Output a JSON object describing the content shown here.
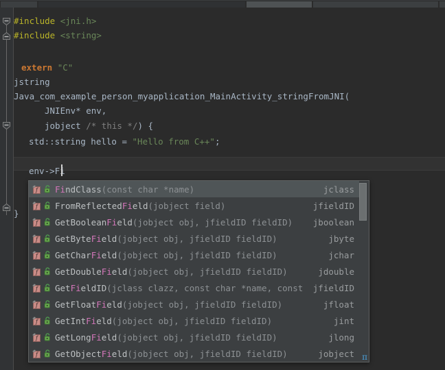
{
  "window": {
    "app": "Android Studio C++ Editor",
    "theme_background": "#2b2b2b",
    "editor_background": "#2b2b2b",
    "gutter_background": "#313335"
  },
  "tabs": [
    {
      "label": "",
      "state": "inactive"
    },
    {
      "label": "",
      "state": "inactive"
    },
    {
      "label": "",
      "state": "active"
    },
    {
      "label": "",
      "state": "inactive"
    },
    {
      "label": "",
      "state": "inactive"
    }
  ],
  "editor": {
    "language": "C++",
    "current_line_index": 8,
    "lines": [
      {
        "indent": 0,
        "fold": "collapsible-start",
        "tokens": [
          {
            "text": "#include ",
            "cls": "k-pre"
          },
          {
            "text": "<jni.h>",
            "cls": "k-hdr"
          }
        ]
      },
      {
        "indent": 0,
        "fold": "collapsible-end",
        "tokens": [
          {
            "text": "#include ",
            "cls": "k-pre"
          },
          {
            "text": "<string>",
            "cls": "k-hdr"
          }
        ]
      },
      {
        "indent": 0,
        "fold": "none",
        "tokens": []
      },
      {
        "indent": 1,
        "fold": "none",
        "tokens": [
          {
            "text": "extern ",
            "cls": "k-kw"
          },
          {
            "text": "\"C\"",
            "cls": "k-str"
          }
        ]
      },
      {
        "indent": 0,
        "fold": "none",
        "tokens": [
          {
            "text": "jstring",
            "cls": "k-plain"
          }
        ]
      },
      {
        "indent": 0,
        "fold": "none",
        "tokens": [
          {
            "text": "Java_com_example_person_myapplication_MainActivity_stringFromJNI(",
            "cls": "k-plain"
          }
        ]
      },
      {
        "indent": 4,
        "fold": "none",
        "tokens": [
          {
            "text": "JNIEnv* env,",
            "cls": "k-plain"
          }
        ]
      },
      {
        "indent": 4,
        "fold": "collapsible-start",
        "tokens": [
          {
            "text": "jobject ",
            "cls": "k-plain"
          },
          {
            "text": "/* this */",
            "cls": "k-cmt"
          },
          {
            "text": ") {",
            "cls": "k-plain"
          }
        ]
      },
      {
        "indent": 2,
        "fold": "none",
        "tokens": [
          {
            "text": "std::string hello = ",
            "cls": "k-plain"
          },
          {
            "text": "\"Hello from C++\"",
            "cls": "k-str"
          },
          {
            "text": ";",
            "cls": "k-plain"
          }
        ]
      },
      {
        "indent": 0,
        "fold": "none",
        "tokens": []
      },
      {
        "indent": 2,
        "fold": "none",
        "current": true,
        "tokens": [
          {
            "text": "env->Fi",
            "cls": "k-plain"
          }
        ]
      },
      {
        "indent": 0,
        "fold": "none",
        "tokens": []
      },
      {
        "indent": 0,
        "fold": "none",
        "tokens": []
      },
      {
        "indent": 0,
        "fold": "collapsible-end",
        "tokens": [
          {
            "text": "}",
            "cls": "k-plain"
          }
        ]
      }
    ],
    "caret_text": "env->Fi"
  },
  "autocomplete": {
    "visible": true,
    "match_prefix": "Fi",
    "selected_index": 0,
    "items": [
      {
        "name_pre": "",
        "name_match": "Fi",
        "name_post": "ndClass",
        "params": "(const char *name)",
        "ret": "jclass",
        "icon": "function-icon",
        "access": "public-lock-icon"
      },
      {
        "name_pre": "FromReflected",
        "name_match": "Fi",
        "name_post": "eld",
        "params": "(jobject field)",
        "ret": "jfieldID",
        "icon": "function-icon",
        "access": "public-lock-icon"
      },
      {
        "name_pre": "GetBoolean",
        "name_match": "Fi",
        "name_post": "eld",
        "params": "(jobject obj, jfieldID fieldID)",
        "ret": "jboolean",
        "icon": "function-icon",
        "access": "public-lock-icon"
      },
      {
        "name_pre": "GetByte",
        "name_match": "Fi",
        "name_post": "eld",
        "params": "(jobject obj, jfieldID fieldID)",
        "ret": "jbyte",
        "icon": "function-icon",
        "access": "public-lock-icon"
      },
      {
        "name_pre": "GetChar",
        "name_match": "Fi",
        "name_post": "eld",
        "params": "(jobject obj, jfieldID fieldID)",
        "ret": "jchar",
        "icon": "function-icon",
        "access": "public-lock-icon"
      },
      {
        "name_pre": "GetDouble",
        "name_match": "Fi",
        "name_post": "eld",
        "params": "(jobject obj, jfieldID fieldID)",
        "ret": "jdouble",
        "icon": "function-icon",
        "access": "public-lock-icon"
      },
      {
        "name_pre": "Get",
        "name_match": "Fi",
        "name_post": "eldID",
        "params": "(jclass clazz, const char *name, const ch⋯",
        "ret": "jfieldID",
        "icon": "function-icon",
        "access": "public-lock-icon"
      },
      {
        "name_pre": "GetFloat",
        "name_match": "Fi",
        "name_post": "eld",
        "params": "(jobject obj, jfieldID fieldID)",
        "ret": "jfloat",
        "icon": "function-icon",
        "access": "public-lock-icon"
      },
      {
        "name_pre": "GetInt",
        "name_match": "Fi",
        "name_post": "eld",
        "params": "(jobject obj, jfieldID fieldID)",
        "ret": "jint",
        "icon": "function-icon",
        "access": "public-lock-icon"
      },
      {
        "name_pre": "GetLong",
        "name_match": "Fi",
        "name_post": "eld",
        "params": "(jobject obj, jfieldID fieldID)",
        "ret": "jlong",
        "icon": "function-icon",
        "access": "public-lock-icon"
      },
      {
        "name_pre": "GetObject",
        "name_match": "Fi",
        "name_post": "eld",
        "params": "(jobject obj, jfieldID fieldID)",
        "ret": "jobject",
        "icon": "function-icon",
        "access": "public-lock-icon"
      }
    ],
    "badge": "π",
    "colors": {
      "background": "#3c3f41",
      "selected_row": "#4f5557",
      "match_text": "#d376b9",
      "name_text": "#bdc0c2",
      "param_text": "#8d9194",
      "badge": "#4a9fd8"
    }
  }
}
